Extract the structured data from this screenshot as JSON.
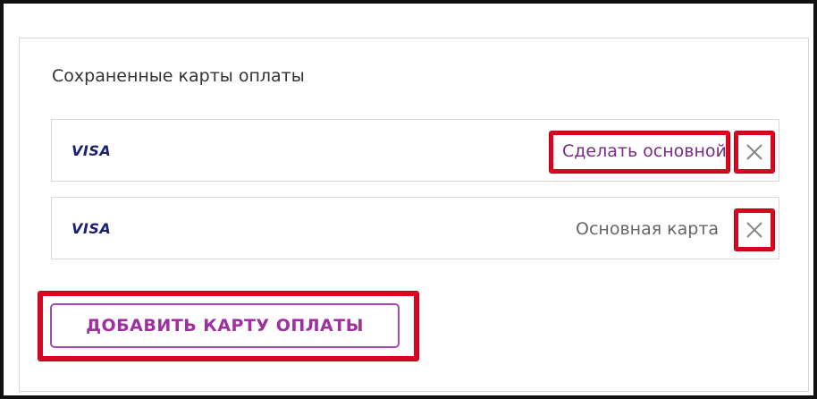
{
  "section": {
    "title": "Сохраненные карты оплаты"
  },
  "cards": [
    {
      "brand": "VISA",
      "action_label": "Сделать основной"
    },
    {
      "brand": "VISA",
      "status_label": "Основная карта"
    }
  ],
  "add_button": {
    "label": "ДОБАВИТЬ КАРТУ ОПЛАТЫ"
  },
  "icons": {
    "remove": "close-icon"
  },
  "colors": {
    "highlight": "#d9061f",
    "accent": "#a0309f",
    "visa": "#1a1f71",
    "link": "#7a2a87"
  }
}
